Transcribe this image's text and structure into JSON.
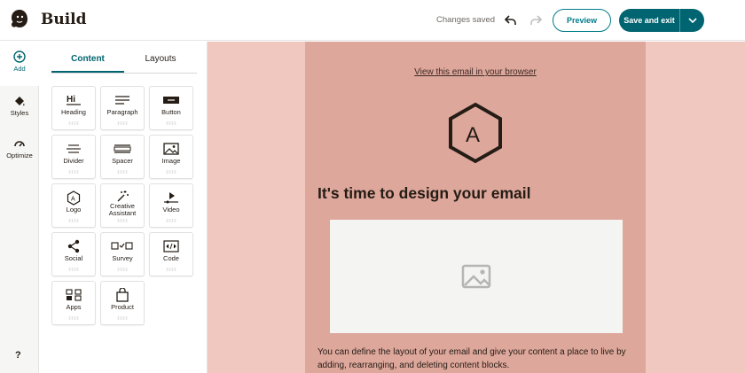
{
  "header": {
    "title": "Build",
    "save_status": "Changes saved",
    "preview_label": "Preview",
    "save_exit_label": "Save and exit"
  },
  "rail": {
    "items": [
      {
        "label": "Add",
        "icon": "add-circle-icon"
      },
      {
        "label": "Styles",
        "icon": "paint-bucket-icon"
      },
      {
        "label": "Optimize",
        "icon": "gauge-icon"
      }
    ],
    "help": "?"
  },
  "panel": {
    "tabs": [
      "Content",
      "Layouts"
    ],
    "active_tab": "Content",
    "blocks": [
      {
        "label": "Heading",
        "icon": "heading-icon"
      },
      {
        "label": "Paragraph",
        "icon": "paragraph-icon"
      },
      {
        "label": "Button",
        "icon": "button-icon"
      },
      {
        "label": "Divider",
        "icon": "divider-icon"
      },
      {
        "label": "Spacer",
        "icon": "spacer-icon"
      },
      {
        "label": "Image",
        "icon": "image-icon"
      },
      {
        "label": "Logo",
        "icon": "logo-icon"
      },
      {
        "label": "Creative Assistant",
        "icon": "sparkle-wand-icon"
      },
      {
        "label": "Video",
        "icon": "video-icon"
      },
      {
        "label": "Social",
        "icon": "share-icon"
      },
      {
        "label": "Survey",
        "icon": "survey-icon"
      },
      {
        "label": "Code",
        "icon": "code-icon"
      },
      {
        "label": "Apps",
        "icon": "apps-icon"
      },
      {
        "label": "Product",
        "icon": "shopping-bag-icon"
      }
    ]
  },
  "email": {
    "browser_link": "View this email in your browser",
    "logo_letter": "A",
    "headline": "It's time to design your email",
    "body": "You can define the layout of your email and give your content a place to live by adding, rearranging, and deleting content blocks."
  },
  "colors": {
    "accent": "#007c89",
    "accent_dark": "#006570",
    "canvas_bg": "#f0c8c0",
    "email_bg": "#dea79b"
  }
}
